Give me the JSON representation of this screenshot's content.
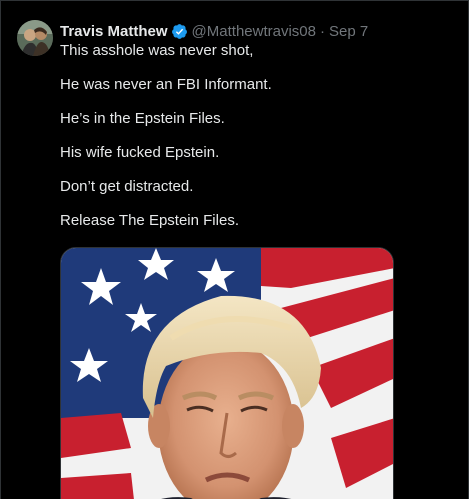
{
  "tweet": {
    "author": {
      "display_name": "Travis Matthew",
      "handle": "@Matthewtravis08",
      "verified_icon": "verified-badge-icon"
    },
    "separator": "·",
    "date": "Sep 7",
    "lines": [
      "This asshole was never shot,",
      "He was never an FBI Informant.",
      "He’s in the Epstein Files.",
      "His wife fucked Epstein.",
      "Don’t get distracted.",
      "Release The Epstein Files."
    ],
    "media": {
      "kind": "photo"
    }
  },
  "colors": {
    "background": "#000000",
    "text": "#e7e9ea",
    "muted": "#71767b",
    "border": "#2f3336",
    "verified": "#1d9bf0"
  }
}
